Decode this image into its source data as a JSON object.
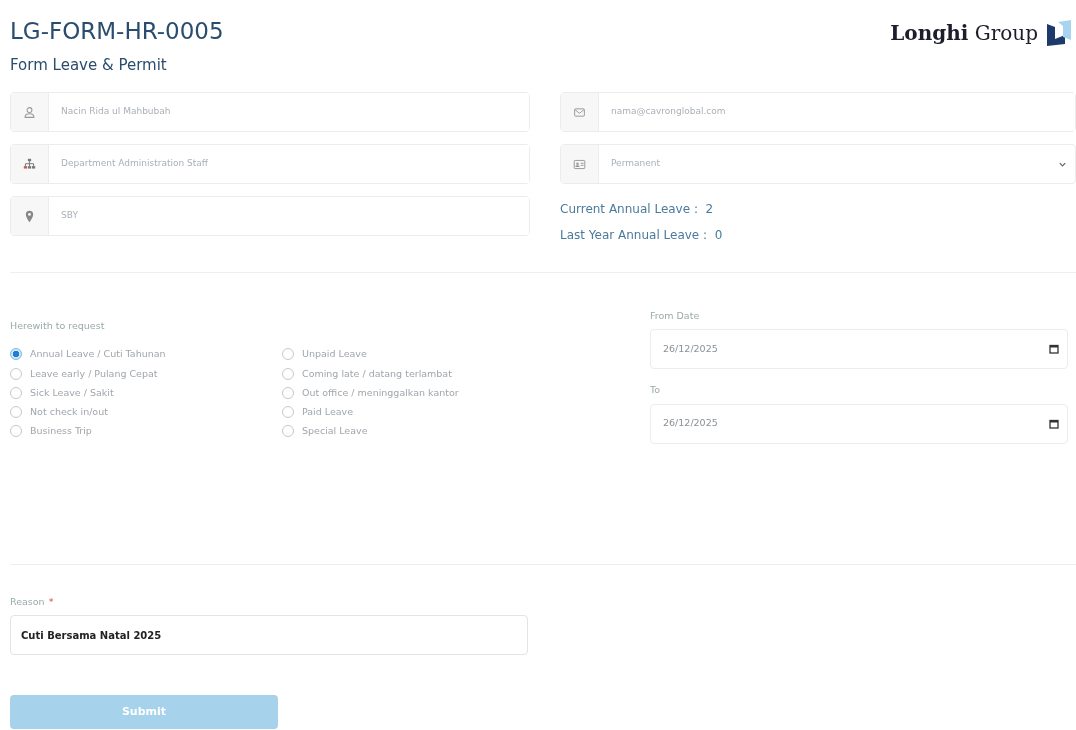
{
  "header": {
    "title": "LG-FORM-HR-0005",
    "subtitle": "Form Leave & Permit",
    "logo_text": "**Longhi** Group"
  },
  "employee_fields": [
    {
      "kind": "person",
      "value": "Nacin Rida ul Mahbubah"
    },
    {
      "kind": "department",
      "value": "Department Administration Staff"
    },
    {
      "kind": "location",
      "value": "SBY"
    }
  ],
  "contact_fields": [
    {
      "kind": "email",
      "value": "nama@cavronglobal.com"
    },
    {
      "kind": "status",
      "value": "Permanent",
      "dropdown": true
    }
  ],
  "leave_balance": [
    {
      "label": "Current Annual Leave :",
      "value": "2"
    },
    {
      "label": "Last Year Annual Leave :",
      "value": "0"
    }
  ],
  "request": {
    "label": "Herewith to request",
    "options": [
      {
        "label": "Annual Leave / Cuti Tahunan",
        "selected": true
      },
      {
        "label": "Leave early / Pulang Cepat",
        "selected": false
      },
      {
        "label": "Sick Leave / Sakit",
        "selected": false
      },
      {
        "label": "Not check in/out",
        "selected": false
      },
      {
        "label": "Business Trip",
        "selected": false
      },
      {
        "label": "Unpaid Leave",
        "selected": false
      },
      {
        "label": "Coming late / datang terlambat",
        "selected": false
      },
      {
        "label": "Out office / meninggalkan kantor",
        "selected": false
      },
      {
        "label": "Paid Leave",
        "selected": false
      },
      {
        "label": "Special Leave",
        "selected": false
      }
    ]
  },
  "dates": [
    {
      "label": "From Date",
      "value": "26/12/2025"
    },
    {
      "label": "To",
      "value": "26/12/2025"
    }
  ],
  "reason": {
    "label": "Reason",
    "required_mark": "*",
    "value": "Cuti Bersama Natal 2025"
  },
  "submit": {
    "label": "Submit",
    "disabled": true
  }
}
